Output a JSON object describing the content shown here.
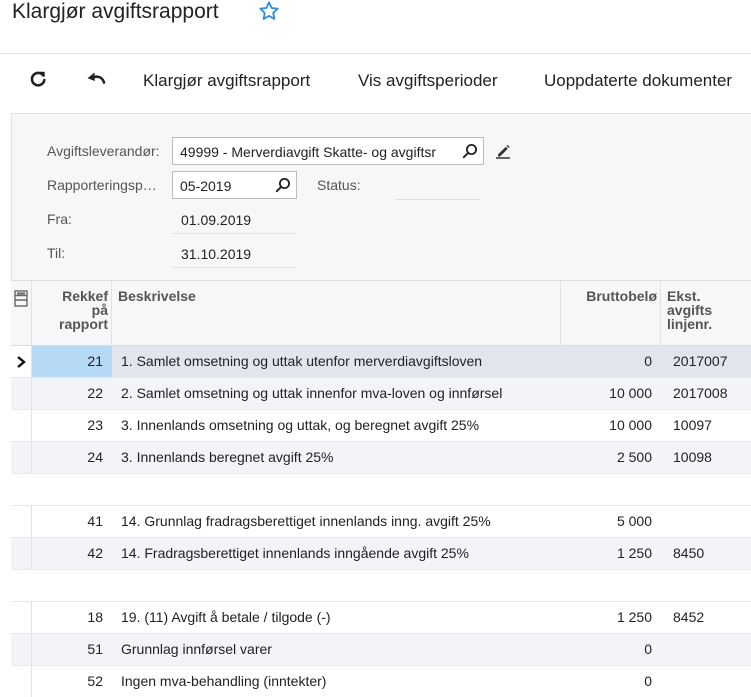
{
  "page": {
    "title": "Klargjør avgiftsrapport"
  },
  "toolbar": {
    "refresh_icon": "refresh-icon",
    "undo_icon": "undo-icon",
    "prepare_label": "Klargjør avgiftsrapport",
    "periods_label": "Vis avgiftsperioder",
    "unreleased_label": "Uoppdaterte dokumenter"
  },
  "form": {
    "vendor_label": "Avgiftsleverandør:",
    "vendor_value": "49999 - Merverdiavgift Skatte- og avgiftsr",
    "period_label": "Rapporteringsp…",
    "period_value": "05-2019",
    "status_label": "Status:",
    "status_value": "",
    "from_label": "Fra:",
    "from_value": "01.09.2019",
    "to_label": "Til:",
    "to_value": "31.10.2019"
  },
  "grid": {
    "columns": {
      "seq": [
        "Rekkef",
        "på",
        "rapport"
      ],
      "desc": "Beskrivelse",
      "gross": "Bruttobelø",
      "ext": [
        "Ekst.",
        "avgifts",
        "linjenr."
      ]
    },
    "rows": [
      {
        "seq": "21",
        "desc": "1. Samlet omsetning og uttak utenfor merverdiavgiftsloven",
        "gross": "0",
        "ext": "2017007"
      },
      {
        "seq": "22",
        "desc": "2. Samlet omsetning og uttak innenfor mva-loven og innførsel",
        "gross": "10 000",
        "ext": "2017008"
      },
      {
        "seq": "23",
        "desc": "3. Innenlands omsetning og uttak, og beregnet avgift 25%",
        "gross": "10 000",
        "ext": "10097"
      },
      {
        "seq": "24",
        "desc": "3. Innenlands beregnet avgift 25%",
        "gross": "2 500",
        "ext": "10098"
      },
      {
        "seq": "41",
        "desc": "14. Grunnlag fradragsberettiget innenlands inng. avgift 25%",
        "gross": "5 000",
        "ext": ""
      },
      {
        "seq": "42",
        "desc": "14. Fradragsberettiget innenlands inngående avgift 25%",
        "gross": "1 250",
        "ext": "8450"
      },
      {
        "seq": "18",
        "desc": "19. (11) Avgift å betale / tilgode (-)",
        "gross": "1 250",
        "ext": "8452"
      },
      {
        "seq": "51",
        "desc": "Grunnlag innførsel varer",
        "gross": "0",
        "ext": ""
      },
      {
        "seq": "52",
        "desc": "Ingen mva-behandling (inntekter)",
        "gross": "0",
        "ext": ""
      }
    ]
  }
}
